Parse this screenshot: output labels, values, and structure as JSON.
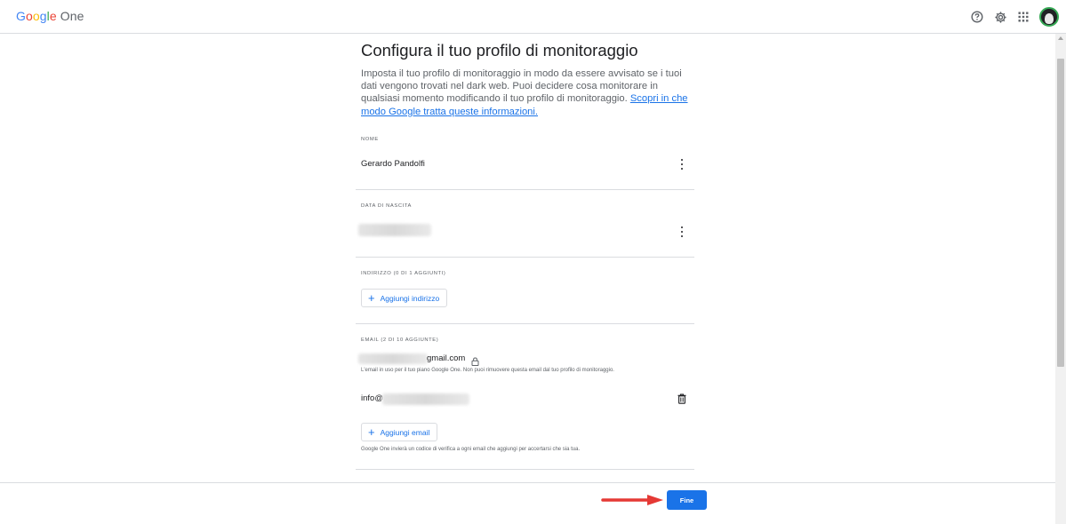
{
  "header": {
    "logo_google": [
      "G",
      "o",
      "o",
      "g",
      "l",
      "e"
    ],
    "logo_product": "One"
  },
  "main": {
    "title": "Configura il tuo profilo di monitoraggio",
    "intro": "Imposta il tuo profilo di monitoraggio in modo da essere avvisato se i tuoi dati vengono trovati nel dark web. Puoi decidere cosa monitorare in qualsiasi momento modificando il tuo profilo di monitoraggio. ",
    "intro_link": "Scopri in che modo Google tratta queste informazioni.",
    "name": {
      "label": "NOME",
      "value": "Gerardo Pandolfi"
    },
    "birth": {
      "label": "DATA DI NASCITA"
    },
    "address": {
      "label": "INDIRIZZO (0 DI 1 AGGIUNTI)",
      "add_label": "Aggiungi indirizzo"
    },
    "email": {
      "label": "EMAIL (2 DI 10 AGGIUNTE)",
      "primary_suffix": "gmail.com",
      "primary_note": "L'email in uso per il tuo piano Google One. Non puoi rimuovere questa email dal tuo profilo di monitoraggio.",
      "secondary_prefix": "info@",
      "add_label": "Aggiungi email",
      "footer_note": "Google One invierà un codice di verifica a ogni email che aggiungi per accertarsi che sia tua."
    }
  },
  "footer": {
    "done_label": "Fine"
  },
  "colors": {
    "accent": "#1a73e8",
    "arrow": "#e53935"
  }
}
